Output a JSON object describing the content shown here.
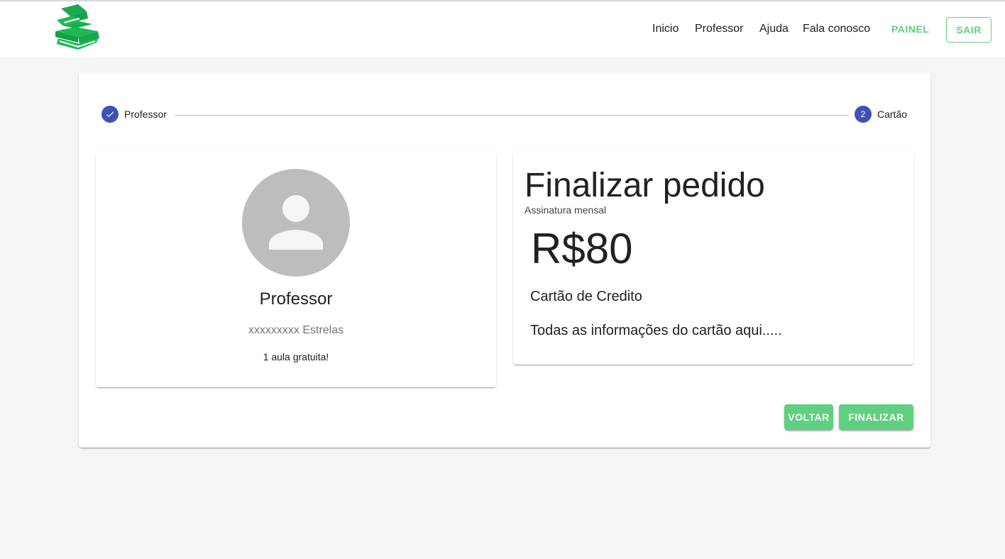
{
  "nav": {
    "logo_icon": "books-logo-icon",
    "links": [
      "Inicio",
      "Professor",
      "Ajuda",
      "Fala conosco"
    ],
    "painel_label": "PAINEL",
    "sair_label": "SAIR"
  },
  "stepper": {
    "steps": [
      {
        "label": "Professor",
        "state": "completed",
        "icon": "check-icon"
      },
      {
        "label": "Cartão",
        "state": "active",
        "number": "2"
      }
    ]
  },
  "teacher": {
    "avatar_icon": "person-icon",
    "name": "Professor",
    "stars": "xxxxxxxxx Estrelas",
    "offer": "1 aula gratuita!"
  },
  "order": {
    "title": "Finalizar pedido",
    "subtitle": "Assinatura mensal",
    "price": "R$80",
    "card_title": "Cartão de Credito",
    "card_info": "Todas as informações do cartão aqui....."
  },
  "actions": {
    "back_label": "VOLTAR",
    "finish_label": "FINALIZAR"
  },
  "colors": {
    "accent_green": "#5fcf80",
    "logo_green": "#1db954",
    "stepper_blue": "#3f51b5",
    "background": "#f5f5f5"
  }
}
